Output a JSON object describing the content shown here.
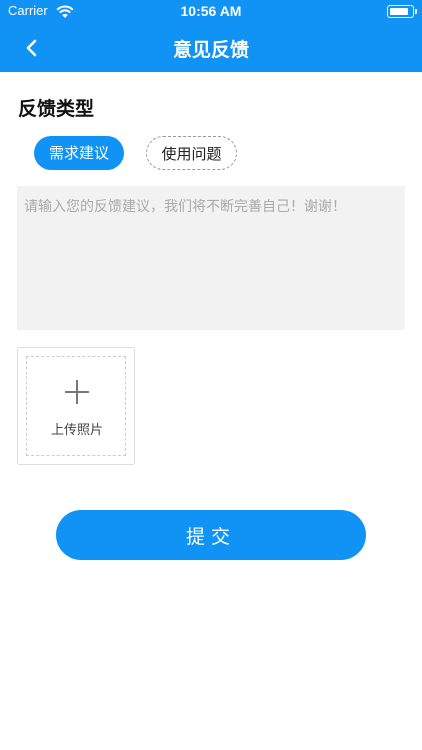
{
  "status_bar": {
    "carrier": "Carrier",
    "time": "10:56 AM",
    "battery_level": 0.9
  },
  "nav": {
    "title": "意见反馈",
    "back_icon": "chevron-left-icon"
  },
  "feedback": {
    "section_title": "反馈类型",
    "types": [
      {
        "label": "需求建议",
        "selected": true
      },
      {
        "label": "使用问题",
        "selected": false
      }
    ],
    "textarea_placeholder": "请输入您的反馈建议，我们将不断完善自己！谢谢！",
    "textarea_value": ""
  },
  "upload": {
    "label": "上传照片",
    "icon": "plus-icon"
  },
  "submit_label": "提交",
  "colors": {
    "primary": "#1093f5",
    "input_bg": "#f2f2f2",
    "placeholder": "#aaaaaa"
  }
}
